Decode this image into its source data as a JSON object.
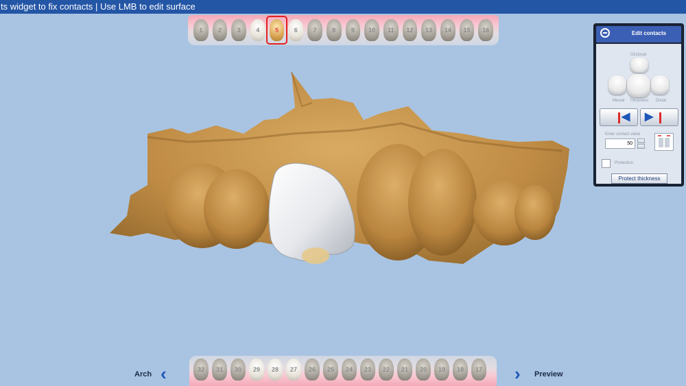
{
  "topbar": {
    "text": "ts widget to fix contacts | Use LMB to edit surface"
  },
  "upper_teeth": [
    {
      "num": "1",
      "tone": "gray"
    },
    {
      "num": "2",
      "tone": "gray"
    },
    {
      "num": "3",
      "tone": "gray"
    },
    {
      "num": "4",
      "tone": "light"
    },
    {
      "num": "5",
      "tone": "gold",
      "selected": true
    },
    {
      "num": "6",
      "tone": "light"
    },
    {
      "num": "7",
      "tone": "gray"
    },
    {
      "num": "8",
      "tone": "gray"
    },
    {
      "num": "9",
      "tone": "gray"
    },
    {
      "num": "10",
      "tone": "gray"
    },
    {
      "num": "11",
      "tone": "gray"
    },
    {
      "num": "12",
      "tone": "gray"
    },
    {
      "num": "13",
      "tone": "gray"
    },
    {
      "num": "14",
      "tone": "gray"
    },
    {
      "num": "15",
      "tone": "gray"
    },
    {
      "num": "16",
      "tone": "gray"
    }
  ],
  "lower_teeth": [
    {
      "num": "32",
      "tone": "gray"
    },
    {
      "num": "31",
      "tone": "gray"
    },
    {
      "num": "30",
      "tone": "gray"
    },
    {
      "num": "29",
      "tone": "light"
    },
    {
      "num": "28",
      "tone": "light"
    },
    {
      "num": "27",
      "tone": "light"
    },
    {
      "num": "26",
      "tone": "gray"
    },
    {
      "num": "25",
      "tone": "gray"
    },
    {
      "num": "24",
      "tone": "gray"
    },
    {
      "num": "23",
      "tone": "gray"
    },
    {
      "num": "22",
      "tone": "gray"
    },
    {
      "num": "21",
      "tone": "gray"
    },
    {
      "num": "20",
      "tone": "gray"
    },
    {
      "num": "19",
      "tone": "gray"
    },
    {
      "num": "18",
      "tone": "gray"
    },
    {
      "num": "17",
      "tone": "gray"
    }
  ],
  "nav": {
    "back_label": "Arch",
    "next_label": "Preview",
    "back_chevron": "‹",
    "next_chevron": "›"
  },
  "panel": {
    "title": "Edit contacts",
    "views": {
      "occlusal": "Occlusal",
      "mesial": "Mesial",
      "thickness": "Thickness",
      "distal": "Distal"
    },
    "contact_label": "Enter contact value",
    "contact_value": "50",
    "protection_label": "Protection",
    "protect_button": "Protect thickness"
  },
  "colors": {
    "background": "#a9c4e2",
    "topbar": "#2456a6",
    "stone": "#c9974f",
    "crown": "#e8eaee",
    "accent": "#1d56b8"
  }
}
